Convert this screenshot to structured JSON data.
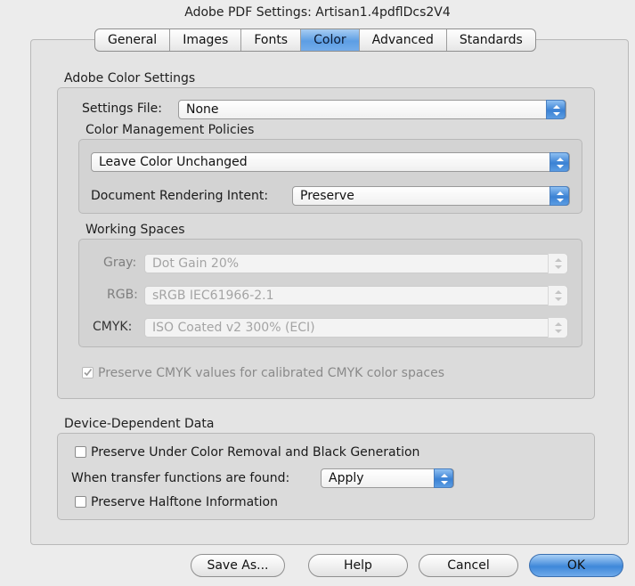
{
  "window": {
    "title": "Adobe PDF Settings: Artisan1.4pdflDcs2V4"
  },
  "tabs": [
    {
      "label": "General",
      "active": false
    },
    {
      "label": "Images",
      "active": false
    },
    {
      "label": "Fonts",
      "active": false
    },
    {
      "label": "Color",
      "active": true
    },
    {
      "label": "Advanced",
      "active": false
    },
    {
      "label": "Standards",
      "active": false
    }
  ],
  "color_settings": {
    "group_label": "Adobe Color Settings",
    "settings_file_label": "Settings File:",
    "settings_file_value": "None",
    "policies": {
      "group_label": "Color Management Policies",
      "policy_value": "Leave Color Unchanged",
      "rendering_intent_label": "Document Rendering Intent:",
      "rendering_intent_value": "Preserve"
    },
    "working_spaces": {
      "group_label": "Working Spaces",
      "gray_label": "Gray:",
      "gray_value": "Dot Gain 20%",
      "rgb_label": "RGB:",
      "rgb_value": "sRGB IEC61966-2.1",
      "cmyk_label": "CMYK:",
      "cmyk_value": "ISO Coated v2 300% (ECI)"
    },
    "preserve_cmyk_label": "Preserve CMYK values for calibrated CMYK color spaces",
    "preserve_cmyk_checked": true
  },
  "device_data": {
    "group_label": "Device-Dependent Data",
    "ucr_label": "Preserve Under Color Removal and Black Generation",
    "ucr_checked": false,
    "transfer_label": "When transfer functions are found:",
    "transfer_value": "Apply",
    "halftone_label": "Preserve Halftone Information",
    "halftone_checked": false
  },
  "buttons": {
    "save_as": "Save As...",
    "help": "Help",
    "cancel": "Cancel",
    "ok": "OK"
  },
  "colors": {
    "accent_blue": "#3f88d9",
    "background": "#ececec"
  }
}
